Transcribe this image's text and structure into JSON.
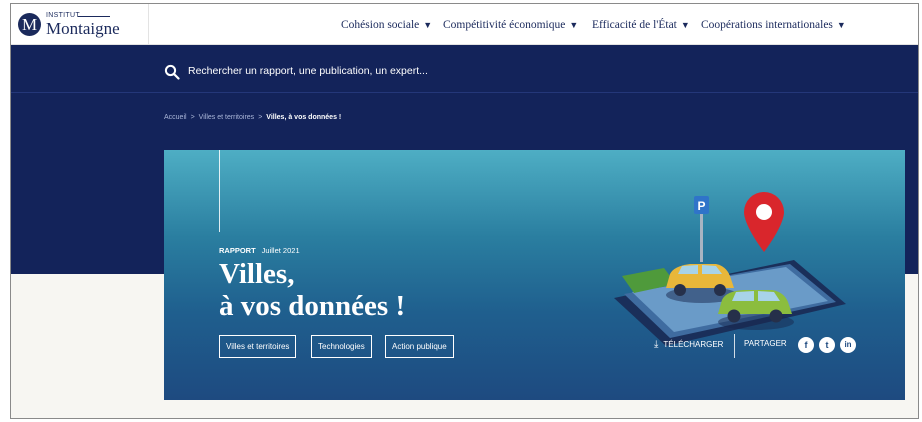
{
  "logo": {
    "small": "INSTITUT",
    "big": "Montaigne",
    "initial": "M"
  },
  "nav": [
    {
      "label": "Cohésion sociale"
    },
    {
      "label": "Compétitivité économique"
    },
    {
      "label": "Efficacité de l'État"
    },
    {
      "label": "Coopérations internationales"
    }
  ],
  "caret": "▼",
  "search": {
    "placeholder": "Rechercher un rapport, une publication, un expert..."
  },
  "breadcrumb": {
    "items": [
      "Accueil",
      "Villes et territoires"
    ],
    "current": "Villes, à vos données !",
    "separator": ">"
  },
  "hero": {
    "type": "RAPPORT",
    "date": "Juillet 2021",
    "title_line1": "Villes,",
    "title_line2": "à vos données !",
    "tags": [
      "Villes et territoires",
      "Technologies",
      "Action publique"
    ],
    "download_label": "TÉLÉCHARGER",
    "share_label": "PARTAGER",
    "parking_sign": "P"
  },
  "social": {
    "facebook": "f",
    "twitter": "t",
    "linkedin": "in"
  },
  "colors": {
    "navy": "#13235a",
    "hero_top": "#4eaec4",
    "hero_bottom": "#1e4a80",
    "pin": "#d9262c"
  }
}
